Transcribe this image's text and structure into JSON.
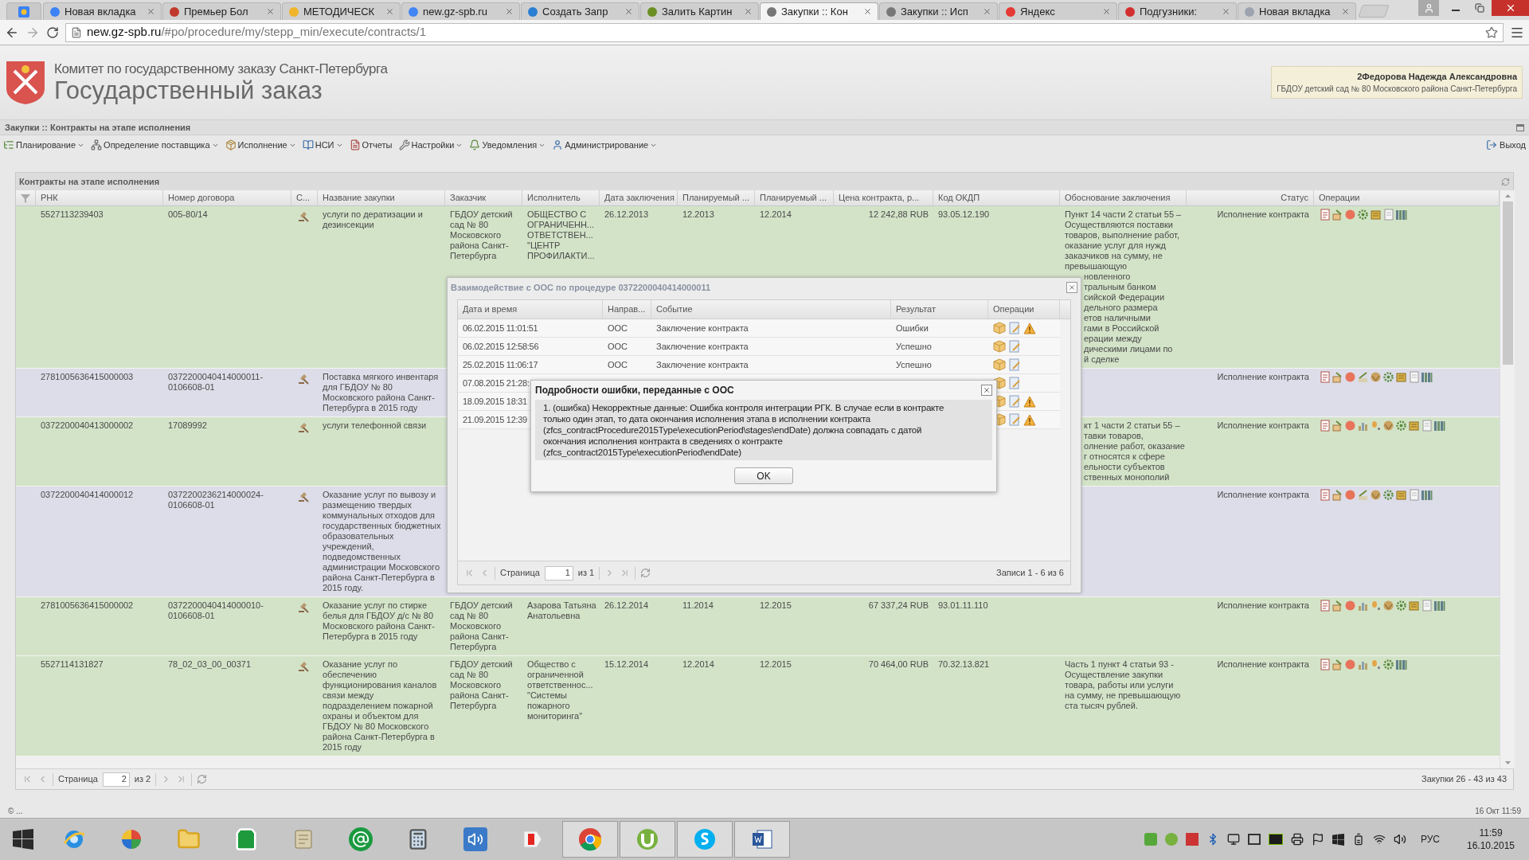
{
  "browser": {
    "tabs": [
      {
        "title": "Новая вкладка",
        "selected": false
      },
      {
        "title": "Премьер Бол",
        "selected": false
      },
      {
        "title": "МЕТОДИЧЕСК",
        "selected": false
      },
      {
        "title": "new.gz-spb.ru",
        "selected": false
      },
      {
        "title": "Создать Запр",
        "selected": false
      },
      {
        "title": "Залить Картин",
        "selected": false
      },
      {
        "title": "Закупки :: Кон",
        "selected": true
      },
      {
        "title": "Закупки :: Исп",
        "selected": false
      },
      {
        "title": "Яндекс",
        "selected": false
      },
      {
        "title": "Подгузники:",
        "selected": false
      },
      {
        "title": "Новая вкладка",
        "selected": false
      }
    ],
    "address": {
      "domain": "new.gz-spb.ru",
      "path": "/#po/procedure/my/stepp_min/execute/contracts/1"
    }
  },
  "header": {
    "org": "Комитет по государственному заказу Санкт-Петербурга",
    "title": "Государственный заказ",
    "user": {
      "name": "2Федорова Надежда Александровна",
      "org": "ГБДОУ детский сад № 80 Московского района Санкт-Петербурга"
    }
  },
  "breadcrumb": "Закупки :: Контракты на этапе исполнения",
  "menu": [
    {
      "label": "Планирование",
      "has_menu": true
    },
    {
      "label": "Определение поставщика",
      "has_menu": true
    },
    {
      "label": "Исполнение",
      "has_menu": true
    },
    {
      "label": "НСИ",
      "has_menu": true
    },
    {
      "label": "Отчеты",
      "has_menu": false
    },
    {
      "label": "Настройки",
      "has_menu": true
    },
    {
      "label": "Уведомления",
      "has_menu": true
    },
    {
      "label": "Администрирование",
      "has_menu": true
    }
  ],
  "logout": "Выход",
  "panel": {
    "title": "Контракты на этапе исполнения",
    "columns": [
      "РНК",
      "Номер договора",
      "С...",
      "Название закупки",
      "Заказчик",
      "Исполнитель",
      "Дата заключения",
      "Планируемый ...",
      "Планируемый ...",
      "Цена контракта, р...",
      "Код ОКДП",
      "Обоснование заключения",
      "Статус",
      "Операции"
    ],
    "rows": [
      {
        "color": "#d3e3c8",
        "rnk": "5527113239403",
        "contract": [
          "005-80/14"
        ],
        "name": [
          "услуги по дератизации и",
          "дезинсекции"
        ],
        "customer": [
          "ГБДОУ детский",
          "сад № 80",
          "Московского",
          "района Санкт-",
          "Петербурга"
        ],
        "executor": [
          "ОБЩЕСТВО С",
          "ОГРАНИЧЕНН...",
          "ОТВЕТСТВЕН...",
          "\"ЦЕНТР",
          "ПРОФИЛАКТИ..."
        ],
        "signed": "26.12.2013",
        "planned_1": "12.2013",
        "planned_2": "12.2014",
        "price": "12 242,88 RUB",
        "okpd": "93.05.12.190",
        "basis": [
          "Пункт 14 части 2 статьи 55 –",
          "Осуществляются поставки",
          "товаров, выполнение работ,",
          "оказание услуг для нужд",
          "заказчиков на сумму, не",
          "превышающую"
        ],
        "basis_cut": [
          "новленного",
          "тральным банком",
          "сийской Федерации",
          "дельного размера",
          "етов наличными",
          "гами в Российской",
          "ерации между",
          "дическими лицами по",
          "й сделке"
        ],
        "status": "Исполнение контракта"
      },
      {
        "color": "#dcdde8",
        "rnk": "2781005636415000003",
        "contract": [
          "0372200040414000011-",
          "0106608-01"
        ],
        "name": [
          "Поставка мягкого инвентаря",
          "для ГБДОУ № 80",
          "Московского района Санкт-",
          "Петербурга в 2015 году"
        ],
        "status": "Исполнение контракта"
      },
      {
        "color": "#d3e3c8",
        "rnk": "0372200040413000002",
        "contract": [
          "17089992"
        ],
        "name": [
          "услуги телефонной связи"
        ],
        "basis_cut": [
          "кт 1 части 2 статьи 55 –",
          "тавки товаров,",
          "олнение работ, оказание",
          "г относятся к сфере",
          "ельности субъектов",
          "ственных монополий"
        ],
        "status": "Исполнение контракта"
      },
      {
        "color": "#dcdde8",
        "rnk": "0372200040414000012",
        "contract": [
          "0372200236214000024-",
          "0106608-01"
        ],
        "name": [
          "Оказание услуг по вывозу и",
          "размещению твердых",
          "коммунальных отходов для",
          "государственных бюджетных",
          "образовательных",
          "учреждений,",
          "подведомственных",
          "администрации Московского",
          "района Санкт-Петербурга в",
          "2015 году."
        ],
        "status": "Исполнение контракта"
      },
      {
        "color": "#d3e3c8",
        "rnk": "2781005636415000002",
        "contract": [
          "0372200040414000010-",
          "0106608-01"
        ],
        "name": [
          "Оказание услуг по стирке",
          "белья для ГБДОУ д/с № 80",
          "Московского района Санкт-",
          "Петербурга в 2015 году"
        ],
        "customer": [
          "ГБДОУ детский",
          "сад № 80",
          "Московского",
          "района Санкт-",
          "Петербурга"
        ],
        "executor": [
          "Азарова Татьяна",
          "Анатольевна"
        ],
        "signed": "26.12.2014",
        "planned_1": "11.2014",
        "planned_2": "12.2015",
        "price": "67 337,24 RUB",
        "okpd": "93.01.11.110",
        "status": "Исполнение контракта"
      },
      {
        "color": "#d3e3c8",
        "rnk": "5527114131827",
        "contract": [
          "78_02_03_00_00371"
        ],
        "name": [
          "Оказание услуг по",
          "обеспечению",
          "функционирования каналов",
          "связи между",
          "подразделением пожарной",
          "охраны и объектом для",
          "ГБДОУ № 80 Московского",
          "района Санкт-Петербурга в",
          "2015 году"
        ],
        "customer": [
          "ГБДОУ детский",
          "сад № 80",
          "Московского",
          "района Санкт-",
          "Петербурга"
        ],
        "executor": [
          "Общество с",
          "ограниченной",
          "ответственнос...",
          "\"Системы",
          "пожарного",
          "мониторинга\""
        ],
        "signed": "15.12.2014",
        "planned_1": "12.2014",
        "planned_2": "12.2015",
        "price": "70 464,00 RUB",
        "okpd": "70.32.13.821",
        "basis": [
          "Часть 1 пункт 4 статьи 93 -",
          "Осуществление закупки",
          "товара, работы или услуги",
          "на сумму, не превышающую",
          "ста тысяч рублей."
        ],
        "status": "Исполнение контракта"
      }
    ],
    "pager": {
      "label": "Страница",
      "page": "2",
      "of": "из 2",
      "summary": "Закупки 26 - 43 из 43"
    }
  },
  "exchange_dialog": {
    "title": "Взаимодействие с ООС по процедуре 0372200040414000011",
    "columns": [
      "Дата и время",
      "Направ...",
      "Событие",
      "Результат",
      "Операции"
    ],
    "rows": [
      {
        "datetime": "06.02.2015 11:01:51",
        "direction": "ООС",
        "event": "Заключение контракта",
        "result": "Ошибки"
      },
      {
        "datetime": "06.02.2015 12:58:56",
        "direction": "ООС",
        "event": "Заключение контракта",
        "result": "Успешно"
      },
      {
        "datetime": "25.02.2015 11:06:17",
        "direction": "ООС",
        "event": "Заключение контракта",
        "result": "Успешно"
      },
      {
        "datetime": "07.08.2015 21:28:"
      },
      {
        "datetime": "18.09.2015 18:31"
      },
      {
        "datetime": "21.09.2015 12:39"
      }
    ],
    "pager": {
      "label": "Страница",
      "page": "1",
      "of": "из 1",
      "summary": "Записи 1 - 6 из 6"
    }
  },
  "error_dialog": {
    "title": "Подробности ошибки, переданные с ООС",
    "message": [
      "1. (ошибка) Некорректные данные: Ошибка контроля интеграции РГК. В случае если в контракте",
      "только один этап, то дата окончания исполнения этапа в исполнении контракта",
      "(zfcs_contractProcedure2015Type\\executionPeriod\\stages\\endDate) должна совпадать с датой",
      "окончания исполнения контракта в сведениях о контракте",
      "(zfcs_contract2015Type\\executionPeriod\\endDate)"
    ],
    "ok": "OK"
  },
  "status_bar": {
    "left": "© ...",
    "right": "16 Окт 11:59"
  },
  "taskbar": {
    "apps": [
      {
        "running": false
      },
      {
        "running": false
      },
      {
        "running": false
      },
      {
        "running": false
      },
      {
        "running": false
      },
      {
        "running": false
      },
      {
        "running": false
      },
      {
        "running": false
      },
      {
        "running": false
      },
      {
        "running": true
      },
      {
        "running": true
      },
      {
        "running": true
      },
      {
        "running": true
      }
    ],
    "language": "РУС",
    "time": "11:59",
    "date": "16.10.2015"
  }
}
